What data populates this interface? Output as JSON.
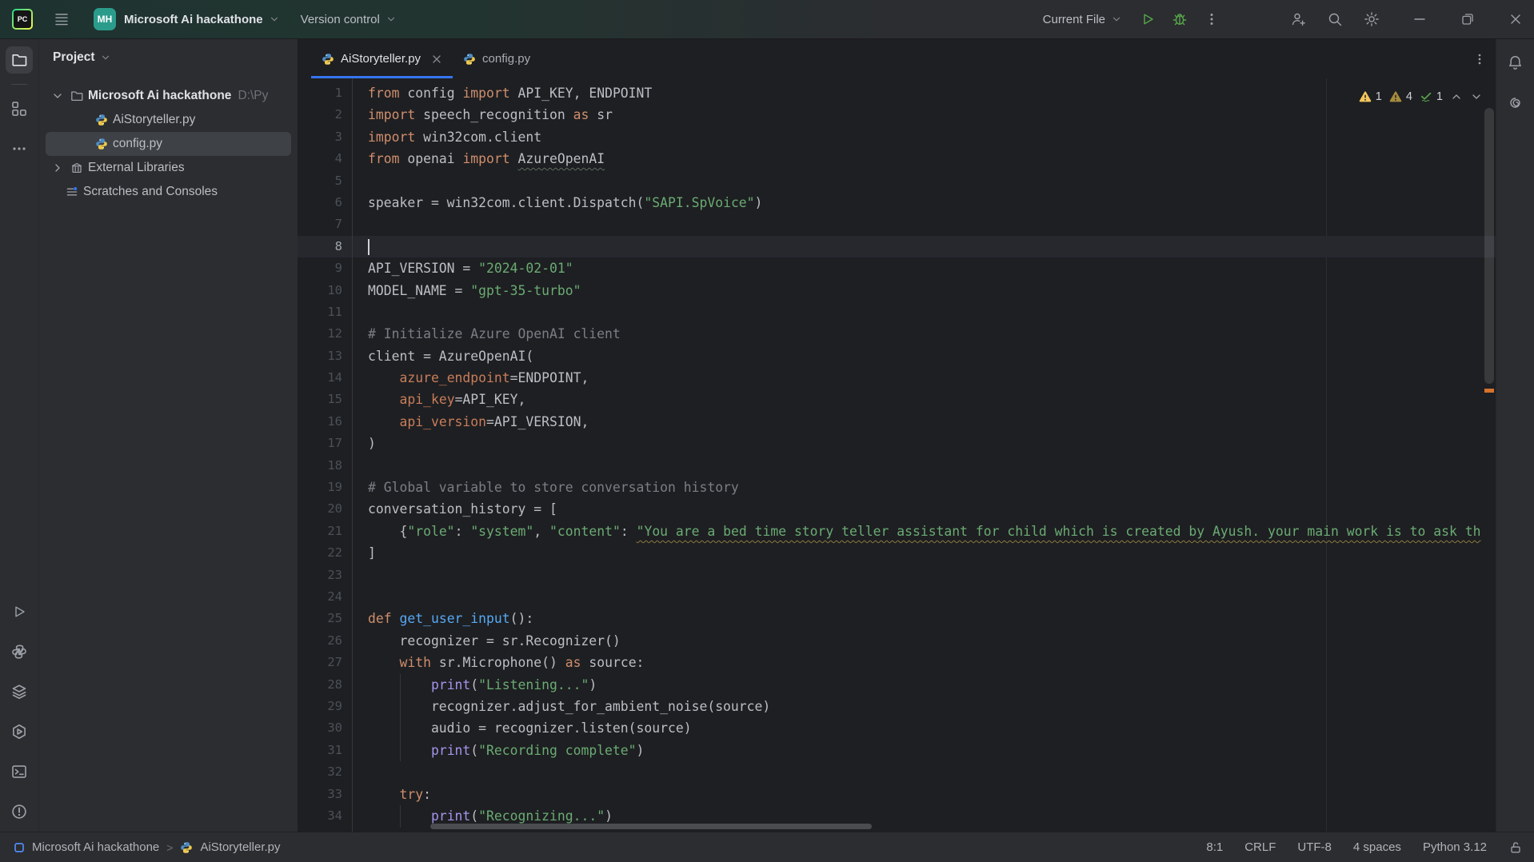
{
  "titlebar": {
    "logo_text": "PC",
    "avatar_initials": "MH",
    "project_name": "Microsoft Ai hackathone",
    "version_control": "Version control",
    "run_config": "Current File"
  },
  "project_panel": {
    "header": "Project",
    "root": {
      "label": "Microsoft Ai hackathone",
      "path": "D:\\Py"
    },
    "files": [
      {
        "label": "AiStoryteller.py"
      },
      {
        "label": "config.py",
        "selected": true
      }
    ],
    "external": "External Libraries",
    "scratches": "Scratches and Consoles"
  },
  "editor": {
    "tabs": [
      {
        "label": "AiStoryteller.py",
        "active": true
      },
      {
        "label": "config.py",
        "active": false
      }
    ],
    "inspections": {
      "warnings": "1",
      "weak_warnings": "4",
      "passed": "1"
    },
    "code": {
      "current_line": 8,
      "caret_col": 0,
      "guides": [
        {
          "col": 4,
          "from": 28,
          "to": 31
        },
        {
          "col": 4,
          "from": 34,
          "to": 34
        }
      ],
      "lines": [
        {
          "n": 1,
          "t": [
            [
              "k",
              "from"
            ],
            [
              "d",
              " config "
            ],
            [
              "k",
              "import"
            ],
            [
              "d",
              " API_KEY, ENDPOINT"
            ]
          ]
        },
        {
          "n": 2,
          "t": [
            [
              "k",
              "import"
            ],
            [
              "d",
              " speech_recognition "
            ],
            [
              "k",
              "as"
            ],
            [
              "d",
              " sr"
            ]
          ]
        },
        {
          "n": 3,
          "t": [
            [
              "k",
              "import"
            ],
            [
              "d",
              " win32com.client"
            ]
          ]
        },
        {
          "n": 4,
          "t": [
            [
              "k",
              "from"
            ],
            [
              "d",
              " openai "
            ],
            [
              "k",
              "import"
            ],
            [
              "d",
              " "
            ],
            [
              "iu",
              "AzureOpenAI"
            ]
          ]
        },
        {
          "n": 5,
          "t": []
        },
        {
          "n": 6,
          "t": [
            [
              "d",
              "speaker = win32com.client.Dispatch("
            ],
            [
              "s",
              "\"SAPI.SpVoice\""
            ],
            [
              "d",
              ")"
            ]
          ]
        },
        {
          "n": 7,
          "t": []
        },
        {
          "n": 8,
          "t": []
        },
        {
          "n": 9,
          "t": [
            [
              "d",
              "API_VERSION = "
            ],
            [
              "s",
              "\"2024-02-01\""
            ]
          ]
        },
        {
          "n": 10,
          "t": [
            [
              "d",
              "MODEL_NAME = "
            ],
            [
              "s",
              "\"gpt-35-turbo\""
            ]
          ]
        },
        {
          "n": 11,
          "t": []
        },
        {
          "n": 12,
          "t": [
            [
              "c",
              "# Initialize Azure OpenAI client"
            ]
          ]
        },
        {
          "n": 13,
          "t": [
            [
              "d",
              "client = AzureOpenAI("
            ]
          ]
        },
        {
          "n": 14,
          "t": [
            [
              "d",
              "    "
            ],
            [
              "n",
              "azure_endpoint"
            ],
            [
              "d",
              "=ENDPOINT,"
            ]
          ]
        },
        {
          "n": 15,
          "t": [
            [
              "d",
              "    "
            ],
            [
              "n",
              "api_key"
            ],
            [
              "d",
              "=API_KEY,"
            ]
          ]
        },
        {
          "n": 16,
          "t": [
            [
              "d",
              "    "
            ],
            [
              "n",
              "api_version"
            ],
            [
              "d",
              "=API_VERSION,"
            ]
          ]
        },
        {
          "n": 17,
          "t": [
            [
              "d",
              ")"
            ]
          ]
        },
        {
          "n": 18,
          "t": []
        },
        {
          "n": 19,
          "t": [
            [
              "c",
              "# Global variable to store conversation history"
            ]
          ]
        },
        {
          "n": 20,
          "t": [
            [
              "d",
              "conversation_history = ["
            ]
          ]
        },
        {
          "n": 21,
          "t": [
            [
              "d",
              "    {"
            ],
            [
              "s",
              "\"role\""
            ],
            [
              "d",
              ": "
            ],
            [
              "s",
              "\"system\""
            ],
            [
              "d",
              ", "
            ],
            [
              "s",
              "\"content\""
            ],
            [
              "d",
              ": "
            ],
            [
              "su",
              "\"You are a bed time story teller assistant for child which is created by Ayush. your main work is to ask th"
            ]
          ]
        },
        {
          "n": 22,
          "t": [
            [
              "d",
              "]"
            ]
          ]
        },
        {
          "n": 23,
          "t": []
        },
        {
          "n": 24,
          "t": []
        },
        {
          "n": 25,
          "t": [
            [
              "k",
              "def "
            ],
            [
              "f",
              "get_user_input"
            ],
            [
              "d",
              "():"
            ]
          ]
        },
        {
          "n": 26,
          "t": [
            [
              "d",
              "    recognizer = sr.Recognizer()"
            ]
          ]
        },
        {
          "n": 27,
          "t": [
            [
              "d",
              "    "
            ],
            [
              "k",
              "with"
            ],
            [
              "d",
              " sr.Microphone() "
            ],
            [
              "k",
              "as"
            ],
            [
              "d",
              " source:"
            ]
          ]
        },
        {
          "n": 28,
          "t": [
            [
              "d",
              "        "
            ],
            [
              "b",
              "print"
            ],
            [
              "d",
              "("
            ],
            [
              "s",
              "\"Listening...\""
            ],
            [
              "d",
              ")"
            ]
          ]
        },
        {
          "n": 29,
          "t": [
            [
              "d",
              "        recognizer.adjust_for_ambient_noise(source)"
            ]
          ]
        },
        {
          "n": 30,
          "t": [
            [
              "d",
              "        audio = recognizer.listen(source)"
            ]
          ]
        },
        {
          "n": 31,
          "t": [
            [
              "d",
              "        "
            ],
            [
              "b",
              "print"
            ],
            [
              "d",
              "("
            ],
            [
              "s",
              "\"Recording complete\""
            ],
            [
              "d",
              ")"
            ]
          ]
        },
        {
          "n": 32,
          "t": []
        },
        {
          "n": 33,
          "t": [
            [
              "d",
              "    "
            ],
            [
              "k",
              "try"
            ],
            [
              "d",
              ":"
            ]
          ]
        },
        {
          "n": 34,
          "t": [
            [
              "d",
              "        "
            ],
            [
              "b",
              "print"
            ],
            [
              "d",
              "("
            ],
            [
              "s",
              "\"Recognizing...\""
            ],
            [
              "d",
              ")"
            ]
          ]
        }
      ]
    }
  },
  "statusbar": {
    "breadcrumb_project": "Microsoft Ai hackathone",
    "breadcrumb_file": "AiStoryteller.py",
    "items": [
      "8:1",
      "CRLF",
      "UTF-8",
      "4 spaces",
      "Python 3.12"
    ]
  },
  "colors": {
    "accent": "#3574f0",
    "run_green": "#57a64a",
    "warning_bright": "#f2c55c",
    "warning_dim": "#a58c3d",
    "string_green": "#6aab73",
    "keyword_orange": "#cf8e6d",
    "error_stripe_mark": "#d5722c",
    "avatar_teal": "#2b9c8c"
  }
}
